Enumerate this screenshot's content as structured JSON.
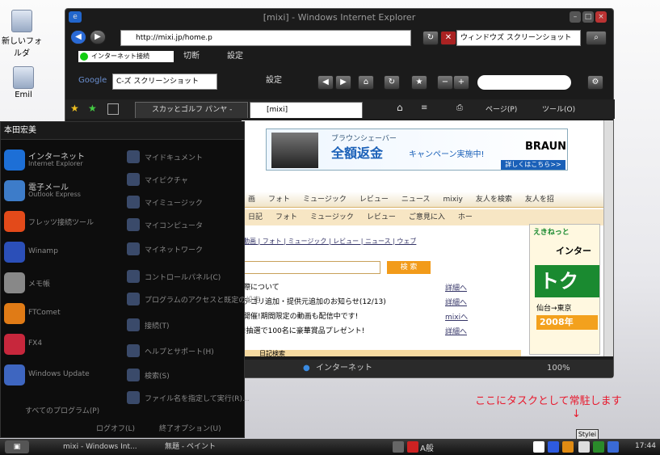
{
  "desktop": {
    "icons": [
      {
        "label": "新しいフォルダ"
      },
      {
        "label": "Emil"
      }
    ]
  },
  "ie": {
    "title": "[mixi] - Windows Internet Explorer",
    "address": "http://mixi.jp/home.p",
    "search_value": "ウィンドウズ スクリーンショット",
    "link_bar": {
      "status": "インターネット接続",
      "block": "切断",
      "settings": "設定"
    },
    "google_bar": {
      "logo": "Google",
      "query": "C-ズ スクリーンショット",
      "settings": "設定"
    },
    "tabs": [
      {
        "label": "スカッとゴルフ パンヤ - ハ..."
      },
      {
        "label": "[mixi]"
      }
    ],
    "command_bar": {
      "page": "ページ(P)",
      "tools": "ツール(O)"
    },
    "status": {
      "zone": "インターネット",
      "zoom": "100%"
    }
  },
  "mixi": {
    "banner": {
      "line1": "ブラウンシェーバー",
      "line2": "全額返金",
      "line3": "キャンペーン実施中!",
      "brand": "BRAUN",
      "link": "詳しくはこちら>>"
    },
    "nav1": [
      "画",
      "フォト",
      "ミュージック",
      "レビュー",
      "ニュース",
      "mixiy",
      "友人を検索",
      "友人を招"
    ],
    "nav2": [
      "日記",
      "フォト",
      "ミュージック",
      "レビュー",
      "ご意見に入",
      "ホー"
    ],
    "subnav": "動画 | フォト | ミュージック | レビュー | ニュース | ウェブ",
    "search_button": "検 索",
    "news": [
      {
        "text": "際について",
        "link": "詳細へ"
      },
      {
        "text": "テゴリ追加・提供元追加のお知らせ(12/13)",
        "link": "詳細へ"
      },
      {
        "text": "開催!期間限定の動画も配信中です!",
        "link": "mixiへ"
      },
      {
        "text": "!抽選で100名に豪華賞品プレゼント!",
        "link": "詳細へ"
      }
    ],
    "footer_label": "日記検索",
    "ad": {
      "top": "えきねっと",
      "mid": "インター",
      "big": "トク",
      "route": "仙台→東京",
      "year": "2008年"
    }
  },
  "start_menu": {
    "user": "本田宏美",
    "left": [
      {
        "title": "インターネット",
        "sub": "Internet Explorer",
        "color": "#1d6fd6"
      },
      {
        "title": "電子メール",
        "sub": "Outlook Express",
        "color": "#3d7cc9"
      },
      {
        "title": "フレッツ接続ツール",
        "sub": "",
        "color": "#e34a1a"
      },
      {
        "title": "Winamp",
        "sub": "",
        "color": "#2b4fb8"
      },
      {
        "title": "メモ帳",
        "sub": "",
        "color": "#888888"
      },
      {
        "title": "FTComet",
        "sub": "",
        "color": "#e07b16"
      },
      {
        "title": "FX4",
        "sub": "",
        "color": "#c7273c"
      },
      {
        "title": "Windows Update",
        "sub": "",
        "color": "#3e66c0"
      }
    ],
    "right": [
      {
        "label": "マイドキュメント"
      },
      {
        "label": "マイピクチャ"
      },
      {
        "label": "マイミュージック"
      },
      {
        "label": "マイコンピュータ"
      },
      {
        "label": "マイネットワーク"
      },
      {
        "label": "コントロールパネル(C)"
      },
      {
        "label": "プログラムのアクセスと既定の設定"
      },
      {
        "label": "接続(T)"
      },
      {
        "label": "ヘルプとサポート(H)"
      },
      {
        "label": "検索(S)"
      },
      {
        "label": "ファイル名を指定して実行(R)..."
      }
    ],
    "all_programs": "すべてのプログラム(P)",
    "logoff": "ログオフ(L)",
    "shutdown": "終了オプション(U)"
  },
  "taskbar": {
    "tasks": [
      {
        "label": "mixi - Windows Int..."
      },
      {
        "label": "無題 - ペイント"
      }
    ],
    "ime": "A般",
    "tooltip": "Stylei",
    "clock": "17:44"
  },
  "annotation": {
    "text": "ここにタスクとして常駐します",
    "arrow": "↓"
  }
}
